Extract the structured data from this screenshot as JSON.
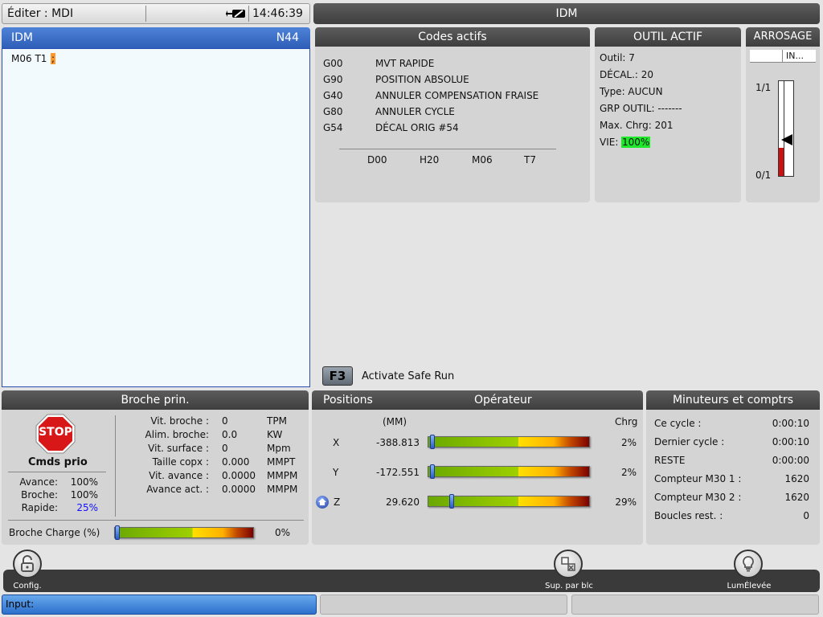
{
  "status_bar": {
    "mode": "Éditer : MDI",
    "time": "14:46:39"
  },
  "main_title": "IDM",
  "editor": {
    "title": "IDM",
    "line_number": "N44",
    "program_text": "M06 T1",
    "cursor_char": ";"
  },
  "active_codes": {
    "title": "Codes actifs",
    "codes": [
      {
        "code": "G00",
        "desc": "MVT RAPIDE"
      },
      {
        "code": "G90",
        "desc": "POSITION ABSOLUE"
      },
      {
        "code": "G40",
        "desc": "ANNULER COMPENSATION FRAISE"
      },
      {
        "code": "G80",
        "desc": "ANNULER CYCLE"
      },
      {
        "code": "G54",
        "desc": "DÉCAL ORIG #54"
      }
    ],
    "bottom": [
      "D00",
      "H20",
      "M06",
      "T7"
    ]
  },
  "active_tool": {
    "title": "OUTIL ACTIF",
    "outil": "Outil: 7",
    "decal": "DÉCAL.: 20",
    "type": "Type: AUCUN",
    "grp": "GRP OUTIL: -------",
    "max_chrg": "Max. Chrg: 201",
    "vie_label": "VIE:",
    "vie_value": "100%"
  },
  "coolant": {
    "title": "ARROSAGE",
    "sub": "IN...",
    "top_label": "1/1",
    "bottom_label": "0/1",
    "level": 0.3
  },
  "f3": {
    "key": "F3",
    "label": "Activate Safe Run"
  },
  "spindle": {
    "title": "Broche prin.",
    "stop_label": "STOP",
    "cmds_label": "Cmds prio",
    "overrides": [
      {
        "label": "Avance:",
        "value": "100%"
      },
      {
        "label": "Broche:",
        "value": "100%"
      },
      {
        "label": "Rapide:",
        "value": "25%"
      }
    ],
    "params": [
      {
        "label": "Vit. broche :",
        "value": "0",
        "unit": "TPM"
      },
      {
        "label": "Alim. broche:",
        "value": "0.0",
        "unit": "KW"
      },
      {
        "label": "Vit. surface :",
        "value": "0",
        "unit": "Mpm"
      },
      {
        "label": "Taille copx :",
        "value": "0.000",
        "unit": "MMPT"
      },
      {
        "label": "Vit. avance :",
        "value": "0.0000",
        "unit": "MMPM"
      },
      {
        "label": "Avance act. :",
        "value": "0.0000",
        "unit": "MMPM"
      }
    ],
    "load_label": "Broche Charge (%)",
    "load_value": "0%",
    "load_fraction": 0.0
  },
  "positions": {
    "title_left": "Positions",
    "title_right": "Opérateur",
    "units": "(MM)",
    "chrg_label": "Chrg",
    "axes": [
      {
        "axis": "X",
        "value": "-388.813",
        "load": "2%",
        "fraction": 0.02
      },
      {
        "axis": "Y",
        "value": "-172.551",
        "load": "2%",
        "fraction": 0.02
      },
      {
        "axis": "Z",
        "value": "29.620",
        "load": "29%",
        "fraction": 0.14
      }
    ]
  },
  "timers": {
    "title": "Minuteurs et comptrs",
    "rows": [
      {
        "label": "Ce cycle :",
        "value": "0:00:10"
      },
      {
        "label": "Dernier cycle :",
        "value": "0:00:10"
      },
      {
        "label": "RESTE",
        "value": "0:00:00"
      },
      {
        "label": "Compteur M30 1 :",
        "value": "1620"
      },
      {
        "label": "Compteur M30 2 :",
        "value": "1620"
      },
      {
        "label": "Boucles rest. :",
        "value": "0"
      }
    ]
  },
  "toolbar": {
    "config": "Config.",
    "sup": "Sup. par blc",
    "lum": "LumÉlevée"
  },
  "input": {
    "label": "Input:"
  }
}
